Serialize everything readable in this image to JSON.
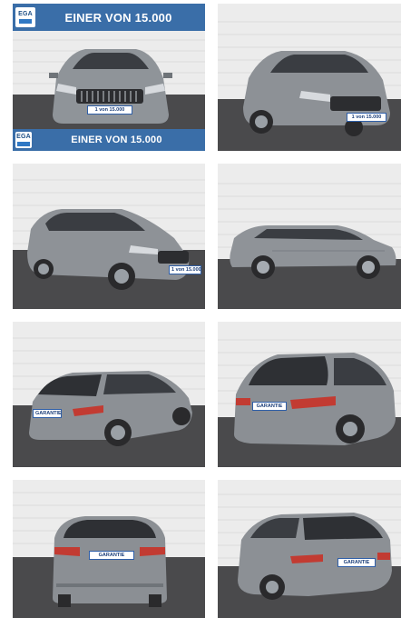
{
  "banner": {
    "top_text": "EINER VON 15.000",
    "bottom_text": "EINER VON 15.000",
    "logo_text": "EGA",
    "color": "#3a6ea8"
  },
  "plates": {
    "front": "1 von 15.000",
    "rear": "GARANTIE"
  },
  "colors": {
    "car_body": "#8d9196",
    "wall": "#ebebeb",
    "floor": "#4a4a4c"
  },
  "gallery": {
    "images": [
      {
        "view": "front"
      },
      {
        "view": "front-right"
      },
      {
        "view": "front-left"
      },
      {
        "view": "side"
      },
      {
        "view": "rear-left"
      },
      {
        "view": "rear-right"
      },
      {
        "view": "rear"
      },
      {
        "view": "rear-right-wide"
      }
    ]
  }
}
